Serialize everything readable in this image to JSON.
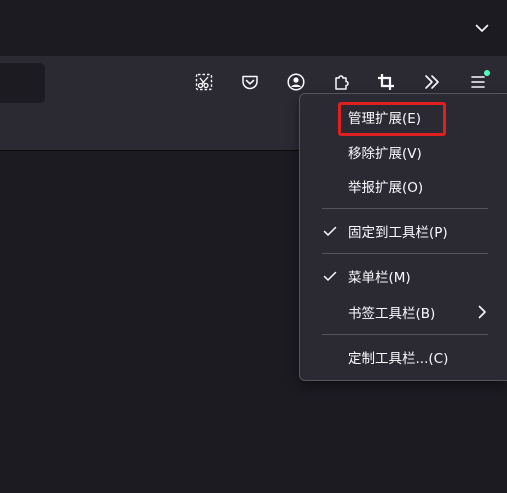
{
  "tabbar": {
    "tab_list_icon": "chevron-down-icon"
  },
  "toolbar": {
    "buttons": [
      {
        "id": "screenshot",
        "icon": "screenshot-icon"
      },
      {
        "id": "pocket",
        "icon": "pocket-icon"
      },
      {
        "id": "account",
        "icon": "account-icon"
      },
      {
        "id": "extensions",
        "icon": "puzzle-icon"
      },
      {
        "id": "crop",
        "icon": "crop-icon"
      },
      {
        "id": "overflow",
        "icon": "double-chevron-right-icon"
      },
      {
        "id": "app-menu",
        "icon": "hamburger-menu-icon",
        "badge_color": "#54ffbd"
      }
    ]
  },
  "context_menu": {
    "items": [
      {
        "label": "管理扩展(E)",
        "checked": false,
        "submenu": false
      },
      {
        "label": "移除扩展(V)",
        "checked": false,
        "submenu": false
      },
      {
        "label": "举报扩展(O)",
        "checked": false,
        "submenu": false
      },
      {
        "label": "固定到工具栏(P)",
        "checked": true,
        "submenu": false
      },
      {
        "label": "菜单栏(M)",
        "checked": true,
        "submenu": false
      },
      {
        "label": "书签工具栏(B)",
        "checked": false,
        "submenu": true
      },
      {
        "label": "定制工具栏...(C)",
        "checked": false,
        "submenu": false
      }
    ]
  },
  "colors": {
    "tabbar_bg": "#1c1b22",
    "toolbar_bg": "#2b2a33",
    "menu_bg": "#2b2a33",
    "menu_border": "#55545c",
    "text": "#fbfbfe",
    "highlight": "#e02020"
  }
}
